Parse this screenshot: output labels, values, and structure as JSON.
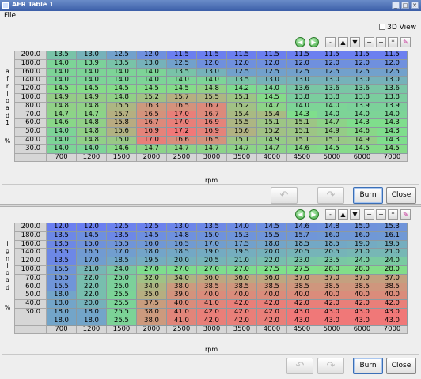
{
  "window": {
    "title": "AFR Table 1",
    "controls": [
      "_",
      "□",
      "✕"
    ]
  },
  "menu": {
    "file": "File"
  },
  "view3d": {
    "label": "3D View",
    "checked": false
  },
  "toolbar": {
    "symbols": [
      "◀",
      "▶",
      "-",
      "▲",
      "▼",
      "−",
      "+",
      "*",
      "✎"
    ]
  },
  "colors": {
    "low": "#6b7ff0",
    "mid": "#7fe08a",
    "high": "#f07878"
  },
  "afr": {
    "y_label": "afrload1",
    "y_unit": "%",
    "x_label": "rpm",
    "rows": [
      "200.0",
      "180.0",
      "160.0",
      "140.0",
      "120.0",
      "100.0",
      "80.0",
      "70.0",
      "60.0",
      "50.0",
      "40.0",
      "30.0"
    ],
    "cols": [
      "700",
      "1200",
      "1500",
      "2000",
      "2500",
      "3000",
      "3500",
      "4000",
      "4500",
      "5000",
      "6000",
      "7000"
    ],
    "values": [
      [
        "13.5",
        "13.0",
        "12.5",
        "12.0",
        "11.5",
        "11.5",
        "11.5",
        "11.5",
        "11.5",
        "11.5",
        "11.5",
        "11.5"
      ],
      [
        "14.0",
        "13.9",
        "13.5",
        "13.0",
        "12.5",
        "12.0",
        "12.0",
        "12.0",
        "12.0",
        "12.0",
        "12.0",
        "12.0"
      ],
      [
        "14.0",
        "14.0",
        "14.0",
        "14.0",
        "13.5",
        "13.0",
        "12.5",
        "12.5",
        "12.5",
        "12.5",
        "12.5",
        "12.5"
      ],
      [
        "14.0",
        "14.0",
        "14.0",
        "14.0",
        "14.0",
        "14.0",
        "13.5",
        "13.0",
        "13.0",
        "13.0",
        "13.0",
        "13.0"
      ],
      [
        "14.5",
        "14.5",
        "14.5",
        "14.5",
        "14.5",
        "14.8",
        "14.2",
        "14.0",
        "13.6",
        "13.6",
        "13.6",
        "13.6"
      ],
      [
        "14.9",
        "14.9",
        "14.8",
        "15.2",
        "15.7",
        "15.5",
        "15.1",
        "14.5",
        "13.8",
        "13.8",
        "13.8",
        "13.8"
      ],
      [
        "14.8",
        "14.8",
        "15.5",
        "16.3",
        "16.5",
        "16.7",
        "15.2",
        "14.7",
        "14.0",
        "14.0",
        "13.9",
        "13.9"
      ],
      [
        "14.7",
        "14.7",
        "15.7",
        "16.5",
        "17.0",
        "16.7",
        "15.4",
        "15.4",
        "14.3",
        "14.0",
        "14.0",
        "14.0"
      ],
      [
        "14.6",
        "14.8",
        "15.8",
        "16.7",
        "17.0",
        "16.9",
        "15.5",
        "15.1",
        "15.1",
        "14.7",
        "14.3",
        "14.3"
      ],
      [
        "14.0",
        "14.8",
        "15.6",
        "16.9",
        "17.2",
        "16.9",
        "15.6",
        "15.2",
        "15.1",
        "14.9",
        "14.6",
        "14.3"
      ],
      [
        "14.0",
        "14.8",
        "15.0",
        "17.0",
        "16.6",
        "16.5",
        "15.1",
        "14.9",
        "15.1",
        "15.0",
        "14.9",
        "14.3"
      ],
      [
        "14.0",
        "14.0",
        "14.6",
        "14.7",
        "14.7",
        "14.7",
        "14.7",
        "14.7",
        "14.6",
        "14.5",
        "14.5",
        "14.5"
      ]
    ]
  },
  "ign": {
    "y_label": "ignload",
    "y_unit": "%",
    "x_label": "rpm",
    "rows": [
      "200.0",
      "180.0",
      "160.0",
      "140.0",
      "120.0",
      "100.0",
      "70.0",
      "60.0",
      "50.0",
      "40.0",
      "30.0"
    ],
    "cols": [
      "700",
      "1200",
      "1500",
      "2000",
      "2500",
      "3000",
      "3500",
      "4000",
      "4500",
      "5000",
      "6000",
      "7000"
    ],
    "values": [
      [
        "12.0",
        "12.0",
        "12.5",
        "12.5",
        "13.0",
        "13.5",
        "14.0",
        "14.5",
        "14.6",
        "14.8",
        "15.0",
        "15.3"
      ],
      [
        "13.5",
        "14.5",
        "13.5",
        "14.5",
        "14.8",
        "15.0",
        "15.3",
        "15.5",
        "15.7",
        "16.0",
        "16.0",
        "16.1"
      ],
      [
        "13.5",
        "15.0",
        "15.5",
        "16.0",
        "16.5",
        "17.0",
        "17.5",
        "18.0",
        "18.5",
        "18.5",
        "19.0",
        "19.5"
      ],
      [
        "13.5",
        "16.5",
        "17.0",
        "18.0",
        "18.5",
        "19.0",
        "19.5",
        "20.0",
        "20.5",
        "20.5",
        "21.0",
        "21.0"
      ],
      [
        "13.5",
        "17.0",
        "18.5",
        "19.5",
        "20.0",
        "20.5",
        "21.0",
        "22.0",
        "23.0",
        "23.5",
        "24.0",
        "24.0"
      ],
      [
        "15.5",
        "21.0",
        "24.0",
        "27.0",
        "27.0",
        "27.0",
        "27.0",
        "27.5",
        "27.5",
        "28.0",
        "28.0",
        "28.0"
      ],
      [
        "15.5",
        "22.0",
        "25.0",
        "32.0",
        "34.0",
        "36.0",
        "36.0",
        "36.0",
        "37.0",
        "37.0",
        "37.0",
        "37.0"
      ],
      [
        "15.5",
        "22.0",
        "25.0",
        "34.0",
        "38.0",
        "38.5",
        "38.5",
        "38.5",
        "38.5",
        "38.5",
        "38.5",
        "38.5"
      ],
      [
        "18.0",
        "22.0",
        "25.5",
        "35.0",
        "39.0",
        "40.0",
        "40.0",
        "40.0",
        "40.0",
        "40.0",
        "40.0",
        "40.0"
      ],
      [
        "18.0",
        "20.0",
        "25.5",
        "37.5",
        "40.0",
        "41.0",
        "42.0",
        "42.0",
        "42.0",
        "42.0",
        "42.0",
        "42.0"
      ],
      [
        "18.0",
        "18.0",
        "25.5",
        "38.0",
        "41.0",
        "42.0",
        "42.0",
        "42.0",
        "43.0",
        "43.0",
        "43.0",
        "43.0"
      ],
      [
        "18.0",
        "18.0",
        "25.5",
        "38.0",
        "41.0",
        "42.0",
        "42.0",
        "42.0",
        "43.0",
        "43.0",
        "43.0",
        "43.0"
      ]
    ]
  },
  "buttons": {
    "undo": "↶",
    "redo": "↷",
    "burn": "Burn",
    "close": "Close"
  }
}
